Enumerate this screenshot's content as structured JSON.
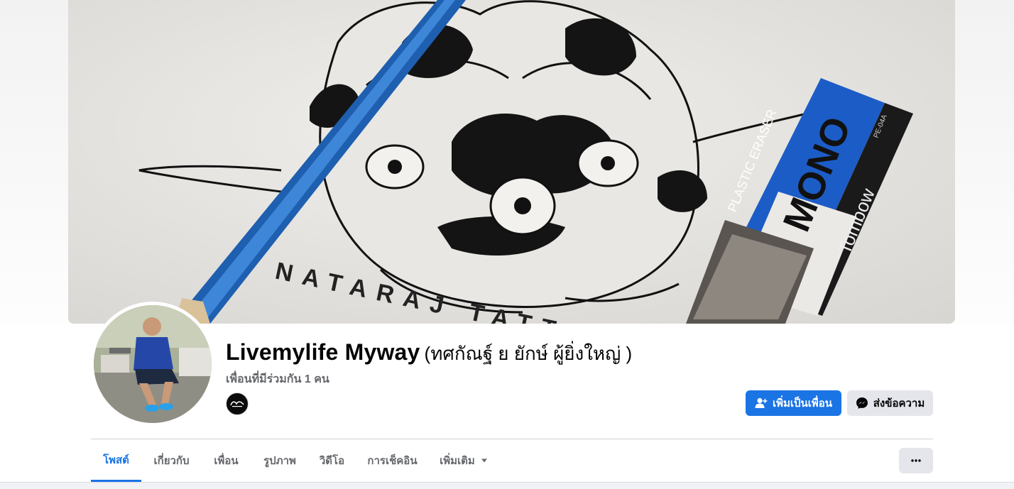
{
  "profile": {
    "name": "Livemylife Myway",
    "alternate_name": "(ทศกัณฐ์ ย ยักษ์ ผู้ยิ่งใหญ่ )",
    "mutual_friends": "เพื่อนที่มีร่วมกัน 1 คน"
  },
  "actions": {
    "add_friend": "เพิ่มเป็นเพื่อน",
    "message": "ส่งข้อความ"
  },
  "tabs": [
    {
      "label": "โพสต์",
      "active": true
    },
    {
      "label": "เกี่ยวกับ",
      "active": false
    },
    {
      "label": "เพื่อน",
      "active": false
    },
    {
      "label": "รูปภาพ",
      "active": false
    },
    {
      "label": "วิดีโอ",
      "active": false
    },
    {
      "label": "การเช็คอิน",
      "active": false
    },
    {
      "label": "เพิ่มเติม",
      "active": false
    }
  ],
  "cover": {
    "eraser_brand": "MONO",
    "eraser_maker": "Tombow",
    "eraser_type": "PLASTIC ERASER",
    "eraser_code": "PE-04A",
    "drawing_text": "NATARAJ TATTOOS"
  },
  "colors": {
    "accent": "#1b74e4",
    "secondary_button": "#e4e6eb",
    "muted_text": "#65676b"
  },
  "icons": {
    "add_friend": "person-plus-icon",
    "message": "messenger-icon",
    "more_dropdown": "caret-down-icon",
    "more_options": "ellipsis-icon"
  }
}
